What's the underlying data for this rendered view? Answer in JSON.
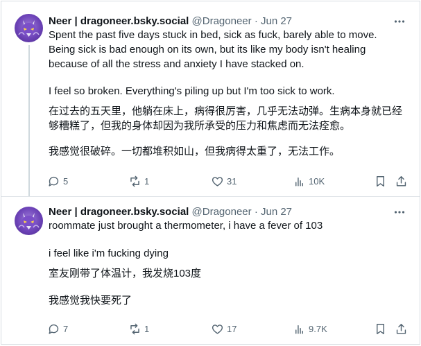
{
  "tweets": [
    {
      "author_name": "Neer | dragoneer.bsky.social",
      "handle": "@Dragoneer",
      "separator": "·",
      "date": "Jun 27",
      "lines": [
        "Spent the past five days stuck in bed, sick as fuck, barely able to move.",
        "Being sick is bad enough on its own, but its like my body isn't healing",
        "because of all the stress and anxiety I have stacked on.",
        "I feel so broken. Everything's piling up  but I'm too sick to work.",
        "在过去的五天里，他躺在床上，病得很厉害，几乎无法动弹。生病本身就已经",
        "够糟糕了，但我的身体却因为我所承受的压力和焦虑而无法痊愈。",
        "我感觉很破碎。一切都堆积如山，但我病得太重了，无法工作。"
      ],
      "stats": {
        "replies": "5",
        "reposts": "1",
        "likes": "31",
        "views": "10K"
      }
    },
    {
      "author_name": "Neer | dragoneer.bsky.social",
      "handle": "@Dragoneer",
      "separator": "·",
      "date": "Jun 27",
      "lines": [
        "roommate just brought a thermometer, i have a fever of 103",
        "i feel like i'm fucking dying",
        "室友刚带了体温计，我发烧103度",
        "我感觉我快要死了"
      ],
      "stats": {
        "replies": "7",
        "reposts": "1",
        "likes": "17",
        "views": "9.7K"
      }
    }
  ],
  "icons": {
    "more": "more-horizontal-icon",
    "reply": "reply-icon",
    "repost": "repost-icon",
    "like": "heart-icon",
    "views": "bar-chart-icon",
    "bookmark": "bookmark-icon",
    "share": "share-icon"
  }
}
